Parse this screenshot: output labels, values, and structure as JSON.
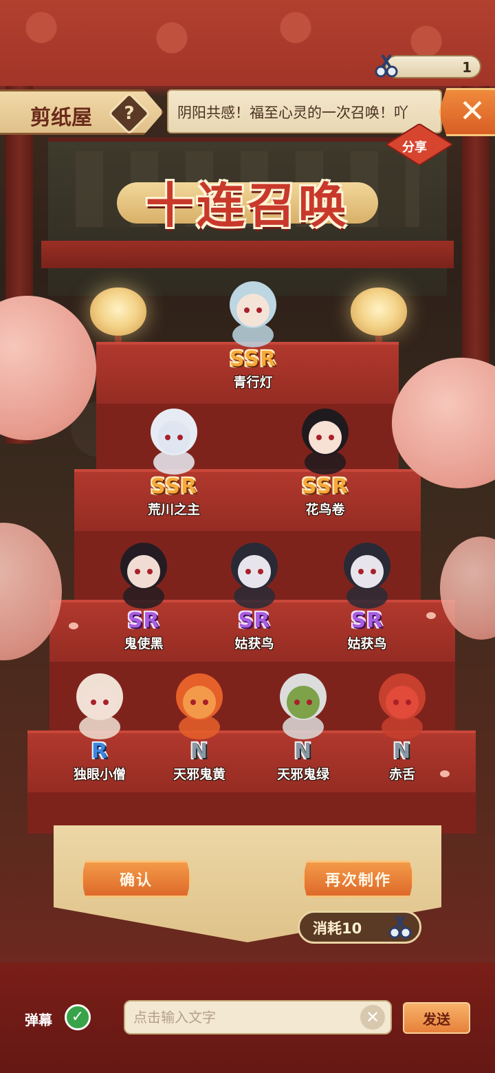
{
  "header": {
    "title": "剪纸屋",
    "help_icon": "help-icon",
    "notice": "阴阳共感！福至心灵的一次召唤！吖",
    "close_icon": "close-icon",
    "share_label": "分享",
    "currency_value": "1"
  },
  "banner": {
    "title": "十连召唤"
  },
  "results": [
    {
      "rarity": "SSR",
      "name": "青行灯"
    },
    {
      "rarity": "SSR",
      "name": "荒川之主"
    },
    {
      "rarity": "SSR",
      "name": "花鸟卷"
    },
    {
      "rarity": "SR",
      "name": "鬼使黑"
    },
    {
      "rarity": "SR",
      "name": "姑获鸟"
    },
    {
      "rarity": "SR",
      "name": "姑获鸟"
    },
    {
      "rarity": "R",
      "name": "独眼小僧"
    },
    {
      "rarity": "N",
      "name": "天邪鬼黄"
    },
    {
      "rarity": "N",
      "name": "天邪鬼绿"
    },
    {
      "rarity": "N",
      "name": "赤舌"
    }
  ],
  "actions": {
    "confirm_label": "确认",
    "redo_label": "再次制作",
    "cost_label": "消耗10"
  },
  "danmaku": {
    "label": "弹幕",
    "toggle_icon": "check-icon",
    "placeholder": "点击输入文字",
    "send_label": "发送"
  },
  "colors": {
    "ssr": "#f6a93a",
    "sr": "#a95de0",
    "r": "#3e86e0",
    "n": "#8a97a4",
    "button_orange": "#e07030"
  }
}
